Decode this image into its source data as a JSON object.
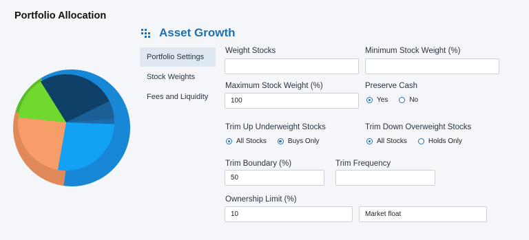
{
  "page_title": "Portfolio Allocation",
  "panel": {
    "title": "Asset Growth",
    "icon": "grid-bars-icon"
  },
  "subnav": {
    "items": [
      {
        "label": "Portfolio Settings"
      },
      {
        "label": "Stock Weights"
      },
      {
        "label": "Fees and Liquidity"
      }
    ]
  },
  "form": {
    "weight_stocks": {
      "label": "Weight Stocks",
      "value": ""
    },
    "min_stock_weight": {
      "label": "Minimum Stock Weight (%)",
      "value": ""
    },
    "max_stock_weight": {
      "label": "Maximum Stock Weight (%)",
      "value": "100"
    },
    "preserve_cash": {
      "label": "Preserve Cash",
      "options": [
        "Yes",
        "No"
      ],
      "selected": "Yes"
    },
    "trim_up": {
      "label": "Trim Up Underweight Stocks",
      "options": [
        "All Stocks",
        "Buys Only"
      ],
      "selected": "All Stocks"
    },
    "trim_down": {
      "label": "Trim Down Overweight Stocks",
      "options": [
        "All Stocks",
        "Holds Only"
      ],
      "selected": "All Stocks"
    },
    "trim_boundary": {
      "label": "Trim Boundary (%)",
      "value": "50"
    },
    "trim_frequency": {
      "label": "Trim Frequency",
      "value": ""
    },
    "ownership_limit": {
      "label": "Ownership Limit (%)",
      "value": "10",
      "basis": "Market float"
    }
  },
  "colors": {
    "accent": "#1f6fb3",
    "outer_blue": "#1887d6",
    "navy": "#0e4068",
    "dark_blue": "#1a5f96",
    "sky": "#12a1f4",
    "orange": "#f79d6a",
    "dark_orange": "#e08a5a",
    "light_green": "#6fd92e",
    "green": "#5cbb29"
  }
}
